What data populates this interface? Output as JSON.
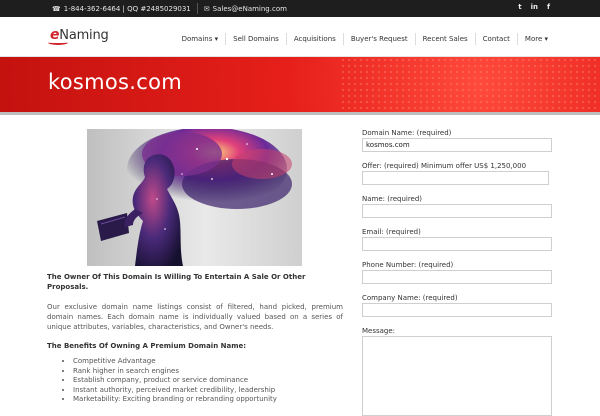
{
  "topbar": {
    "phone": "1-844-362-6464 | QQ #2485029031",
    "email": "Sales@eNaming.com",
    "social": [
      "twitter-icon",
      "linkedin-icon",
      "facebook-icon"
    ],
    "social_glyphs": [
      "t",
      "in",
      "f"
    ]
  },
  "logo": {
    "prefix": "e",
    "rest": "Naming"
  },
  "nav": {
    "items": [
      "Domains ▾",
      "Sell Domains",
      "Acquisitions",
      "Buyer's Request",
      "Recent Sales",
      "Contact",
      "More ▾"
    ]
  },
  "hero": {
    "title": "kosmos.com",
    "color": "#e61f1a"
  },
  "content": {
    "heading": "The Owner Of This Domain Is Willing To Entertain A Sale Or Other Proposals.",
    "paragraph": "Our exclusive domain name listings consist of filtered, hand picked, premium domain names. Each domain name is individually valued based on a series of unique attributes, variables, characteristics, and Owner's needs.",
    "benefits_heading": "The Benefits Of Owning A Premium Domain Name:",
    "benefits": [
      "Competitive Advantage",
      "Rank higher in search engines",
      "Establish company, product or service dominance",
      "Instant authority, perceived market credibility, leadership",
      "Marketability: Exciting branding or rebranding opportunity"
    ]
  },
  "form": {
    "domain_label": "Domain Name: (required)",
    "domain_value": "kosmos.com",
    "offer_label": "Offer: (required) Minimum offer US$ 1,250,000",
    "name_label": "Name: (required)",
    "email_label": "Email: (required)",
    "phone_label": "Phone Number: (required)",
    "company_label": "Company Name: (required)",
    "message_label": "Message:"
  }
}
